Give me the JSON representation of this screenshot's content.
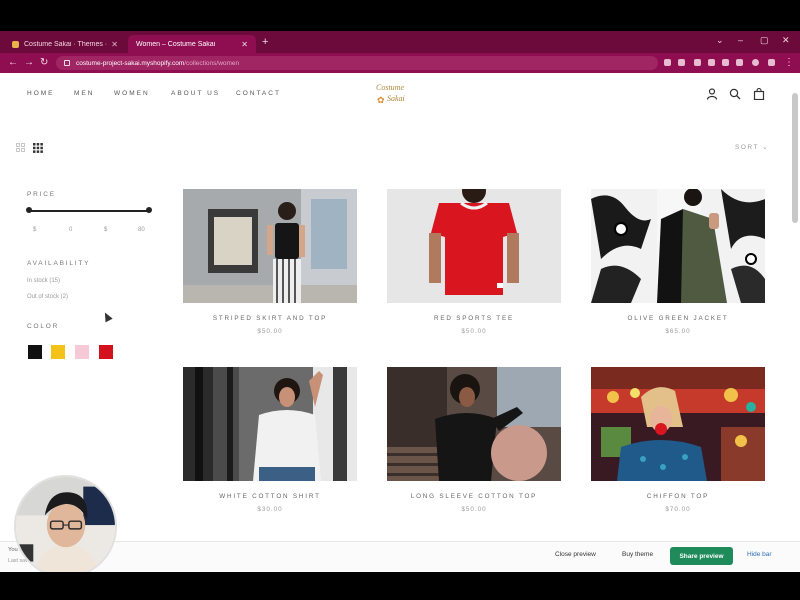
{
  "browser": {
    "tabs": [
      {
        "title": "Costume Sakai · Themes · Sho",
        "active": false
      },
      {
        "title": "Women – Costume Sakai",
        "active": true
      }
    ],
    "new_tab": "+",
    "url_host": "costume-project-sakai.myshopify.com",
    "url_path": "/collections/women",
    "window_controls": [
      "⌄",
      "–",
      "▢",
      "✕"
    ]
  },
  "store": {
    "nav": [
      "HOME",
      "MEN",
      "WOMEN",
      "ABOUT US",
      "CONTACT"
    ],
    "logo_line1": "Costume",
    "logo_line2": "Sakai",
    "logo_mark": "✿",
    "sort_label": "SORT ⌄"
  },
  "filters": {
    "price_heading": "PRICE",
    "price_fields": [
      "$",
      "0",
      "$",
      "80"
    ],
    "availability_heading": "AVAILABILITY",
    "availability_options": [
      "In stock (15)",
      "Out of stock (2)"
    ],
    "color_heading": "COLOR",
    "colors": [
      "#111111",
      "#f3c31a",
      "#f6c9d6",
      "#d4101f"
    ]
  },
  "products": [
    {
      "name": "STRIPED SKIRT AND TOP",
      "price": "$50.00"
    },
    {
      "name": "RED SPORTS TEE",
      "price": "$50.00"
    },
    {
      "name": "OLIVE GREEN JACKET",
      "price": "$65.00"
    },
    {
      "name": "WHITE COTTON SHIRT",
      "price": "$30.00"
    },
    {
      "name": "LONG SLEEVE COTTON TOP",
      "price": "$50.00"
    },
    {
      "name": "CHIFFON TOP",
      "price": "$70.00"
    }
  ],
  "preview_bar": {
    "theme_line": "You are previewing Prestige",
    "saved_line": "Last saved on Jul 28, 12:00 am EST",
    "close_label": "Close preview",
    "buy_label": "Buy theme",
    "share_label": "Share preview",
    "more_label": "Hide bar"
  },
  "accent_color": "#8e0e51",
  "icons": [
    "back-icon",
    "forward-icon",
    "reload-icon",
    "lock-icon",
    "account-icon",
    "search-icon",
    "cart-icon",
    "grid-two-icon",
    "grid-four-icon"
  ]
}
